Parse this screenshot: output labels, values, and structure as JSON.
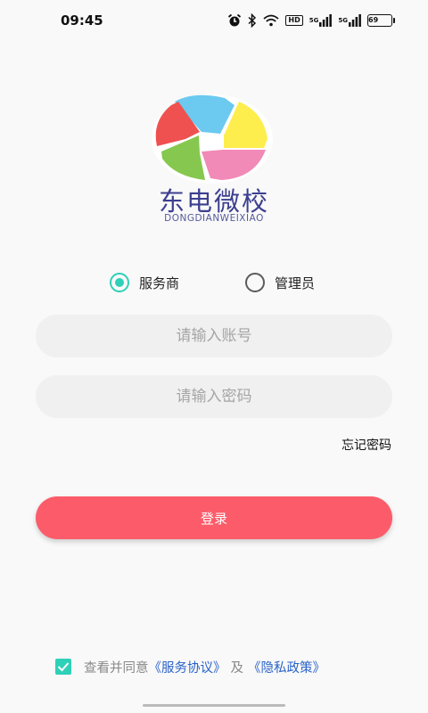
{
  "status_bar": {
    "time": "09:45",
    "hd_label": "HD",
    "sim1_label": "5G",
    "sim2_label": "5G",
    "battery_level": "69",
    "icons": [
      "alarm-icon",
      "bluetooth-icon",
      "wifi-icon",
      "signal-icon",
      "battery-icon"
    ]
  },
  "brand": {
    "name_cn": "东电微校",
    "name_en": "DONGDIANWEIXIAO"
  },
  "roles": {
    "options": [
      {
        "label": "服务商",
        "selected": true
      },
      {
        "label": "管理员",
        "selected": false
      }
    ]
  },
  "form": {
    "account_placeholder": "请输入账号",
    "password_placeholder": "请输入密码",
    "forgot_label": "忘记密码",
    "login_label": "登录"
  },
  "agreement": {
    "checked": true,
    "prefix": "查看并同意",
    "service_link": "《服务协议》",
    "conjunction": "及",
    "privacy_link": "《隐私政策》"
  },
  "colors": {
    "accent_teal": "#2fd0b8",
    "login_button": "#fc5c6a",
    "link_blue": "#2b63c8",
    "brand_text": "#3c3f8f"
  }
}
